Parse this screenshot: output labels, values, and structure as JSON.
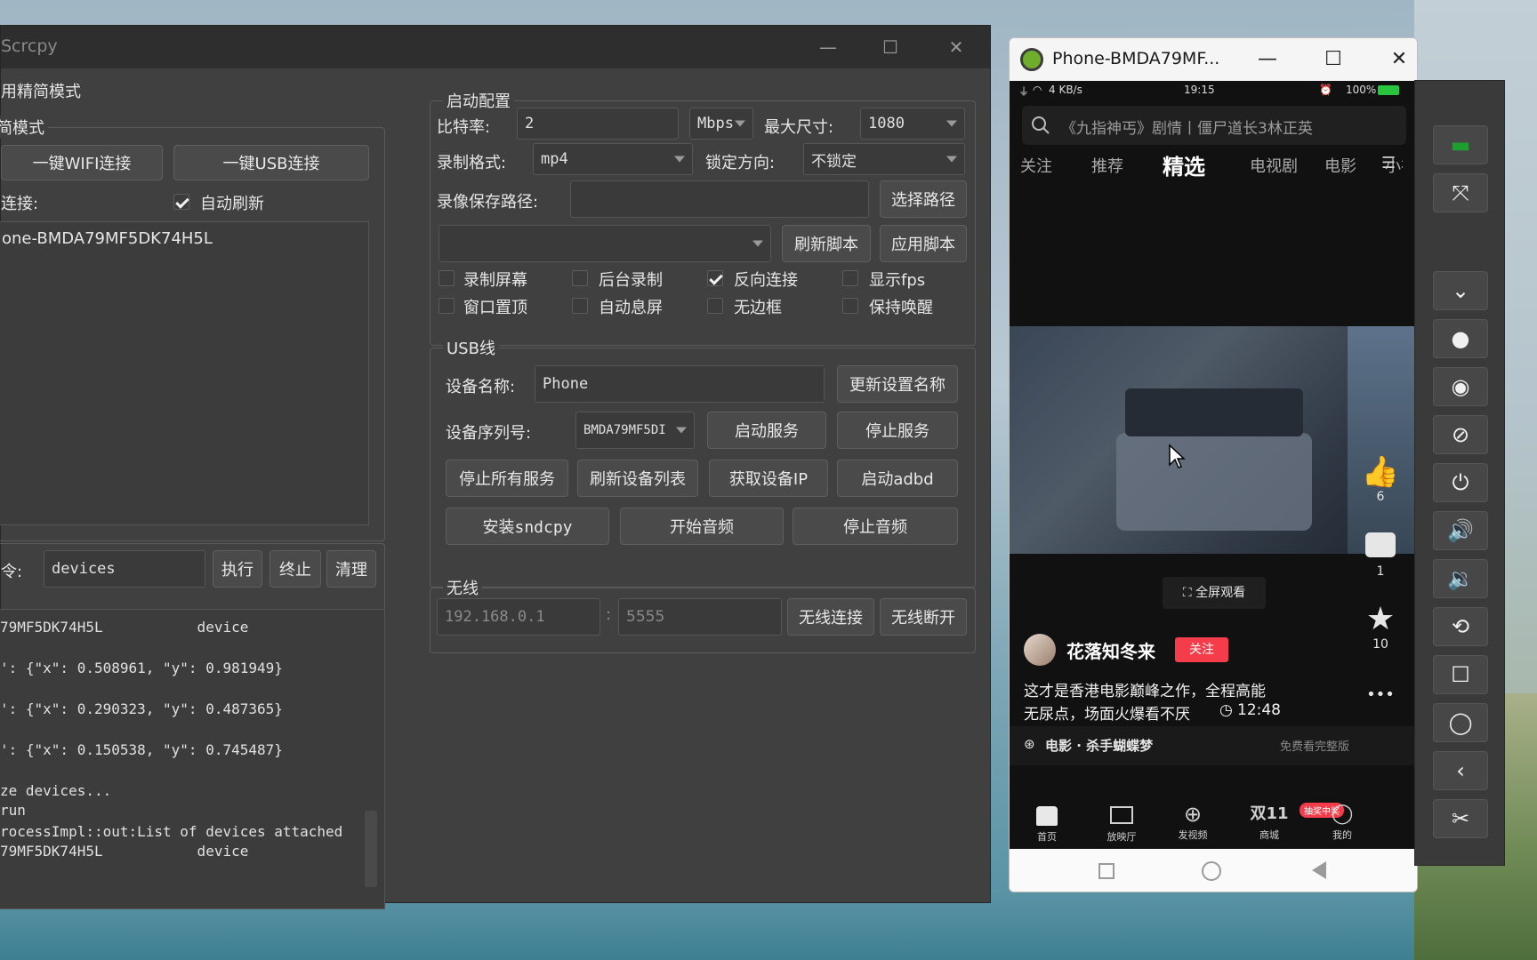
{
  "window": {
    "title": "Scrcpy",
    "min": "—",
    "max": "☐",
    "close": "✕"
  },
  "left": {
    "simple_mode": "用精简模式",
    "mode_group": "简模式",
    "wifi_btn": "一键WIFI连接",
    "usb_btn": "一键USB连接",
    "connect_label": "连接:",
    "auto_refresh": "自动刷新",
    "device_item": "one-BMDA79MF5DK74H5L",
    "cmd_label": "令:",
    "cmd_value": "devices",
    "exec_btn": "执行",
    "stop_btn": "终止",
    "clear_btn": "清理",
    "log": [
      "79MF5DK74H5L           device",
      "': {\"x\": 0.508961, \"y\": 0.981949}",
      "': {\"x\": 0.290323, \"y\": 0.487365}",
      "': {\"x\": 0.150538, \"y\": 0.745487}",
      "ze devices...",
      "run",
      "rocessImpl::out:List of devices attached",
      "79MF5DK74H5L           device"
    ]
  },
  "start": {
    "group": "启动配置",
    "bitrate_label": "比特率:",
    "bitrate_value": "2",
    "bitrate_unit": "Mbps",
    "maxsize_label": "最大尺寸:",
    "maxsize_value": "1080",
    "format_label": "录制格式:",
    "format_value": "mp4",
    "orient_label": "锁定方向:",
    "orient_value": "不锁定",
    "path_label": "录像保存路径:",
    "path_value": "",
    "choose_path": "选择路径",
    "script_value": "",
    "refresh_script": "刷新脚本",
    "apply_script": "应用脚本",
    "checks": [
      {
        "label": "录制屏幕",
        "on": false
      },
      {
        "label": "后台录制",
        "on": false
      },
      {
        "label": "反向连接",
        "on": true
      },
      {
        "label": "显示fps",
        "on": false
      },
      {
        "label": "窗口置顶",
        "on": false
      },
      {
        "label": "自动息屏",
        "on": false
      },
      {
        "label": "无边框",
        "on": false
      },
      {
        "label": "保持唤醒",
        "on": false
      }
    ]
  },
  "usb": {
    "group": "USB线",
    "name_label": "设备名称:",
    "name_value": "Phone",
    "update_name": "更新设置名称",
    "serial_label": "设备序列号:",
    "serial_value": "BMDA79MF5DI",
    "start_service": "启动服务",
    "stop_service": "停止服务",
    "stop_all": "停止所有服务",
    "refresh_list": "刷新设备列表",
    "get_ip": "获取设备IP",
    "start_adbd": "启动adbd",
    "install_sndcpy": "安装sndcpy",
    "start_audio": "开始音频",
    "stop_audio": "停止音频"
  },
  "wireless": {
    "group": "无线",
    "ip_placeholder": "192.168.0.1",
    "colon": ":",
    "port_placeholder": "5555",
    "connect": "无线连接",
    "disconnect": "无线断开"
  },
  "phone": {
    "title": "Phone-BMDA79MF...",
    "min": "—",
    "max": "☐",
    "close": "✕",
    "status_left": "4 KB/s",
    "status_time": "19:15",
    "status_battery": "100%",
    "search": "《九指神丐》剧情丨僵尸道长3林正英",
    "tabs": [
      "关注",
      "推荐",
      "精选",
      "电视剧",
      "电影",
      "小视频"
    ],
    "menu": "☰",
    "likes": "6",
    "comments": "1",
    "favs": "10",
    "more": "•••",
    "fullscreen": "全屏观看",
    "author": "花落知冬来",
    "follow": "关注",
    "desc1": "这才是香港电影巅峰之作，全程高能",
    "desc2": "无尿点，场面火爆看不厌",
    "duration": "12:48",
    "movie_link": "电影 · 杀手蝴蝶梦",
    "free_full": "免费看完整版",
    "nav": [
      "首页",
      "放映厅",
      "发视频",
      "商城",
      "我的"
    ],
    "nav_badge": "抽奖中奖",
    "nav_mall_icon": "双11"
  },
  "colors": {
    "follow_red": "#f43c4a",
    "accent_green": "#1e9e2f"
  }
}
